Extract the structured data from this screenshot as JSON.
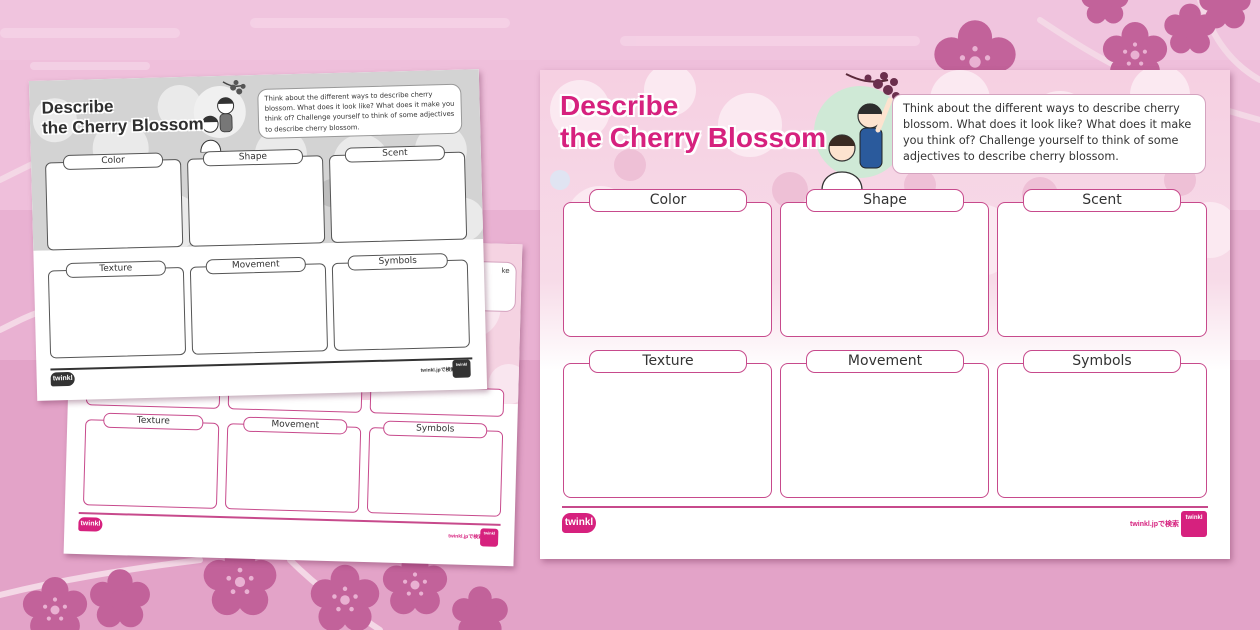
{
  "main_sheet": {
    "title_line1": "Describe",
    "title_line2": "the Cherry Blossom",
    "instructions": "Think about the different ways to describe cherry blossom. What does it look like? What does it make you think of? Challenge yourself to think of some adjectives to describe cherry blossom.",
    "boxes": [
      "Color",
      "Shape",
      "Scent",
      "Texture",
      "Movement",
      "Symbols"
    ],
    "logo": "twinkl",
    "footer_text": "twinkl.jpで検索",
    "badge": "twinkl"
  },
  "greyscale_sheet": {
    "title_line1": "Describe",
    "title_line2": "the Cherry Blossom",
    "instructions": "Think about the different ways to describe cherry blossom. What does it look like? What does it make you think of? Challenge yourself to think of some adjectives to describe cherry blossom.",
    "boxes": [
      "Color",
      "Shape",
      "Scent",
      "Texture",
      "Movement",
      "Symbols"
    ],
    "logo": "twinkl",
    "footer_text": "twinkl.jpで検索",
    "badge": "twinkl"
  },
  "colour_back_sheet": {
    "boxes": [
      "Texture",
      "Movement",
      "Symbols"
    ],
    "instruction_fragment": "ke",
    "logo": "twinkl",
    "footer_text": "twinkl.jpで検索",
    "badge": "twinkl"
  },
  "colors": {
    "background": "#e8aed0",
    "accent_pink": "#d6217e",
    "box_border": "#c74a8c",
    "sakura_dark": "#c2629a"
  },
  "icons": [
    "sakura-flower-icon",
    "twinkl-logo-icon",
    "kids-illustration"
  ]
}
